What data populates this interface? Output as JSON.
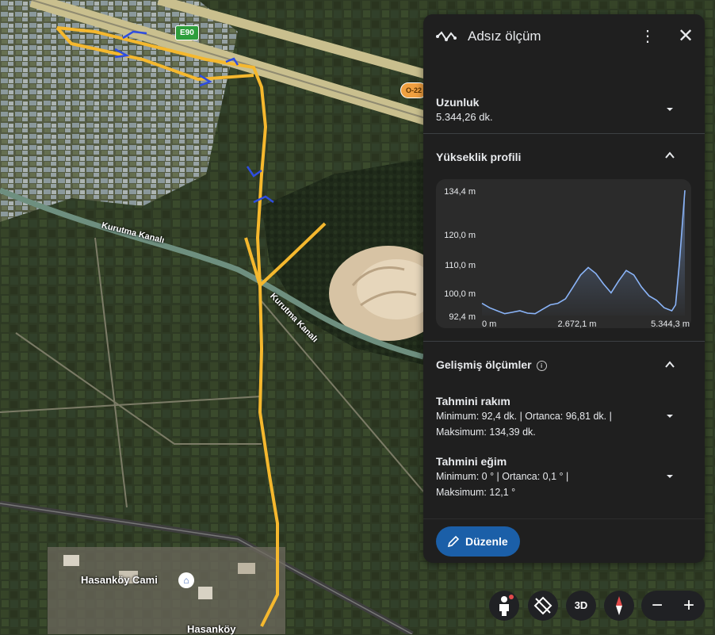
{
  "map": {
    "labels": {
      "canal_1": "Kurutma Kanalı",
      "canal_2": "Kurutma Kanalı",
      "mosque": "Hasanköy Cami",
      "village": "Hasanköy"
    },
    "road_shields": {
      "e90": "E90",
      "o22": "O-22"
    }
  },
  "panel": {
    "title": "Adsız ölçüm",
    "length": {
      "title": "Uzunluk",
      "value": "5.344,26 dk."
    },
    "elevation_profile": {
      "title": "Yükseklik profili",
      "y_ticks": [
        "134,4 m",
        "120,0 m",
        "110,0 m",
        "100,0 m",
        "92,4 m"
      ],
      "x_ticks": [
        "0 m",
        "2.672,1 m",
        "5.344,3 m"
      ]
    },
    "advanced": {
      "title": "Gelişmiş ölçümler",
      "elevation": {
        "title": "Tahmini rakım",
        "line1": "Minimum: 92,4 dk. | Ortanca: 96,81 dk. |",
        "line2": "Maksimum: 134,39 dk."
      },
      "slope": {
        "title": "Tahmini eğim",
        "line1": "Minimum: 0 ° | Ortanca: 0,1 ° |",
        "line2": "Maksimum: 12,1 °"
      }
    },
    "edit_button": "Düzenle"
  },
  "controls": {
    "three_d": "3D"
  },
  "colors": {
    "path": "#f5b82e",
    "chart_line": "#8ab4f8",
    "panel_bg": "#1f1f1f",
    "button_bg": "#1b5fa8"
  },
  "chart_data": {
    "type": "area",
    "xlabel": "",
    "ylabel": "",
    "ylim": [
      92.4,
      134.4
    ],
    "xlim": [
      0,
      5344.3
    ],
    "y_ticks": [
      92.4,
      100.0,
      110.0,
      120.0,
      134.4
    ],
    "x_ticks": [
      0,
      2672.1,
      5344.3
    ],
    "series": [
      {
        "x": [
          0,
          200,
          400,
          600,
          800,
          1000,
          1200,
          1400,
          1600,
          1800,
          2000,
          2200,
          2400,
          2600,
          2800,
          3000,
          3200,
          3400,
          3600,
          3800,
          4000,
          4200,
          4400,
          4600,
          4800,
          4900,
          5000,
          5100,
          5200,
          5344.3
        ],
        "y": [
          96.5,
          95.0,
          94.0,
          93.0,
          93.5,
          94.0,
          93.2,
          93.0,
          94.5,
          96.0,
          96.5,
          98.0,
          102.0,
          106.0,
          108.5,
          106.5,
          103.0,
          100.0,
          104.0,
          107.5,
          106.0,
          102.0,
          99.0,
          97.5,
          95.0,
          94.5,
          94.0,
          96.0,
          110.0,
          134.4
        ]
      }
    ]
  }
}
